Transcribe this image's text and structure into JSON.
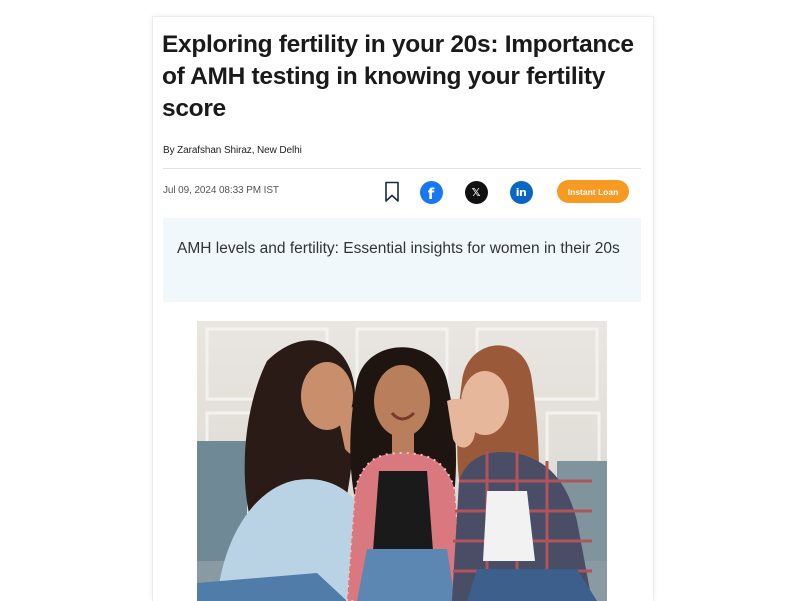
{
  "article": {
    "headline": "Exploring fertility in your 20s: Importance of AMH testing in knowing your fertility score",
    "byline": "By Zarafshan Shiraz, New Delhi",
    "date": "Jul 09, 2024 08:33 PM IST",
    "summary": "AMH levels and fertility: Essential insights for women in their 20s"
  },
  "actions": {
    "bookmark_icon": "bookmark-icon",
    "facebook": {
      "icon": "facebook-icon",
      "glyph": "f",
      "color": "#1877f2"
    },
    "x": {
      "icon": "x-icon",
      "glyph": "𝕏",
      "color": "#111111"
    },
    "linkedin": {
      "icon": "linkedin-icon",
      "glyph": "in",
      "color": "#0a66c2"
    },
    "loan_button": {
      "label": "Instant Loan",
      "color": "#f79a21"
    }
  },
  "colors": {
    "summary_bg": "#f0f8fc",
    "headline": "#1a1a1a"
  }
}
